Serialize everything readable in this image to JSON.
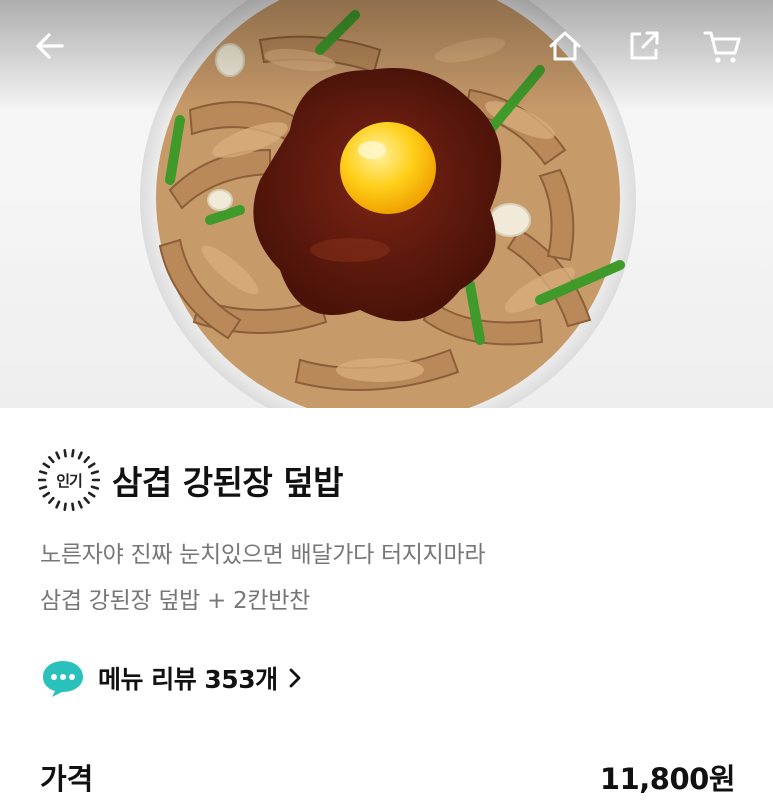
{
  "header": {
    "back_icon": "arrow-left-icon",
    "home_icon": "home-icon",
    "share_icon": "share-icon",
    "cart_icon": "cart-icon"
  },
  "hero": {
    "image": "bowl-of-pork-belly-with-doenjang-sauce-and-egg-yolk"
  },
  "menu": {
    "badge": "인기",
    "title": "삼겹 강된장 덮밥",
    "description_line1": "노른자야 진짜 눈치있으면 배달가다 터지지마라",
    "description_line2": "삼겹 강된장 덮밥 + 2칸반찬"
  },
  "review": {
    "icon": "chat-bubble-icon",
    "label": "메뉴 리뷰 353개",
    "accent_color": "#2ac1bc"
  },
  "price": {
    "label": "가격",
    "value": "11,800원"
  }
}
